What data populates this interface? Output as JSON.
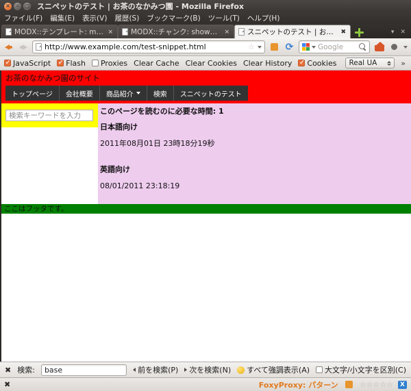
{
  "window": {
    "title": "スニペットのテスト | お茶のなかみつ園 - Mozilla Firefox",
    "close_label": "×",
    "minimize_label": "–",
    "maximize_label": "□"
  },
  "menubar": {
    "items": [
      {
        "label": "ファイル(F)"
      },
      {
        "label": "編集(E)"
      },
      {
        "label": "表示(V)"
      },
      {
        "label": "履歴(S)"
      },
      {
        "label": "ブックマーク(B)"
      },
      {
        "label": "ツール(T)"
      },
      {
        "label": "ヘルプ(H)"
      }
    ]
  },
  "tabs": {
    "items": [
      {
        "label": "MODX::テンプレート: mytpl",
        "active": false,
        "close": "×"
      },
      {
        "label": "MODX::チャンク: showdate_ja",
        "active": false,
        "close": "×"
      },
      {
        "label": "スニペットのテスト | お茶のな...",
        "active": true,
        "close": "✖"
      }
    ],
    "new_tab_label": "+",
    "list_all_label": "▾",
    "close_all_label": "✕"
  },
  "navbar": {
    "back_label": "戻る",
    "forward_label": "進む",
    "url": "http://www.example.com/test-snippet.html",
    "bookmark_star": "☆",
    "dropdown_caret": "▾",
    "feed_label": "RSS",
    "reload_label": "⟳",
    "search_engine": "Google",
    "search_placeholder": "Google",
    "home_label": "ホーム",
    "overflow_label": "▾"
  },
  "devbar": {
    "items": [
      {
        "label": "JavaScript",
        "type": "checkbox",
        "checked": true
      },
      {
        "label": "Flash",
        "type": "checkbox",
        "checked": true
      },
      {
        "label": "Proxies",
        "type": "checkbox",
        "checked": false
      },
      {
        "label": "Clear Cache",
        "type": "link"
      },
      {
        "label": "Clear Cookies",
        "type": "link"
      },
      {
        "label": "Clear History",
        "type": "link"
      },
      {
        "label": "Cookies",
        "type": "checkbox",
        "checked": true
      }
    ],
    "ua_select_value": "Real UA",
    "overflow_label": "»"
  },
  "page": {
    "site_title": "お茶のなかみつ園のサイト",
    "nav": [
      {
        "label": "トップページ",
        "has_caret": false
      },
      {
        "label": "会社概要",
        "has_caret": false
      },
      {
        "label": "商品紹介",
        "has_caret": true
      },
      {
        "label": "検索",
        "has_caret": false
      },
      {
        "label": "スニペットのテスト",
        "has_caret": false
      }
    ],
    "sidebar": {
      "search_placeholder": "検索キーワードを入力",
      "search_value": ""
    },
    "content": {
      "read_time": "このページを読むのに必要な時間: 1",
      "ja_heading": "日本語向け",
      "ja_date": "2011年08月01日 23時18分19秒",
      "en_heading": "英語向け",
      "en_date": "08/01/2011 23:18:19"
    },
    "footer": "ここはフッタです。"
  },
  "findbar": {
    "close_label": "✖",
    "label": "検索:",
    "value": "base",
    "previous_label": "前を検索(P)",
    "next_label": "次を検索(N)",
    "highlight_all_label": "すべて強調表示(A)",
    "match_case_label": "大文字/小文字を区別(C)",
    "match_case_checked": false
  },
  "statusbar": {
    "close_label": "✖",
    "foxyproxy_label": "FoxyProxy: パターン",
    "stars": "☆☆☆☆☆",
    "badge_label": "X"
  },
  "colors": {
    "header_red": "#ff0000",
    "sidebar_yellow": "#ffff00",
    "content_pink": "#eeccee",
    "footer_green": "#008000",
    "nav_dark": "#333333",
    "foxyproxy_orange": "#e07b1f"
  }
}
